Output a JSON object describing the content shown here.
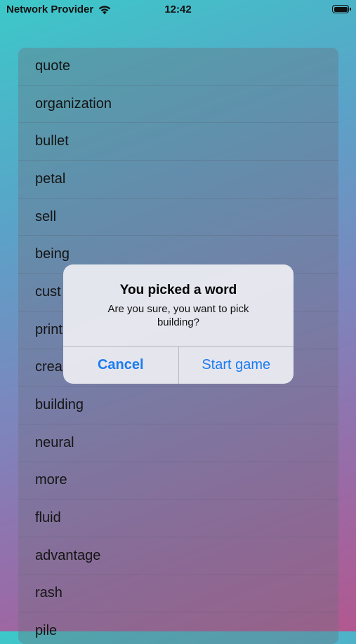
{
  "status_bar": {
    "carrier": "Network Provider",
    "time": "12:42",
    "wifi_icon": "wifi-icon",
    "battery_icon": "battery-icon"
  },
  "word_list": {
    "items": [
      {
        "label": "quote"
      },
      {
        "label": "organization"
      },
      {
        "label": "bullet"
      },
      {
        "label": "petal"
      },
      {
        "label": "sell"
      },
      {
        "label": "being"
      },
      {
        "label": "cust"
      },
      {
        "label": "print"
      },
      {
        "label": "crea"
      },
      {
        "label": "building"
      },
      {
        "label": "neural"
      },
      {
        "label": "more"
      },
      {
        "label": "fluid"
      },
      {
        "label": "advantage"
      },
      {
        "label": "rash"
      },
      {
        "label": "pile"
      }
    ]
  },
  "alert": {
    "title": "You picked a word",
    "message": "Are you sure, you want to pick building?",
    "cancel_label": "Cancel",
    "confirm_label": "Start game"
  },
  "colors": {
    "accent": "#1a7cf0",
    "gradient_top": "#3cc8c9",
    "gradient_bottom": "#b2588f"
  }
}
